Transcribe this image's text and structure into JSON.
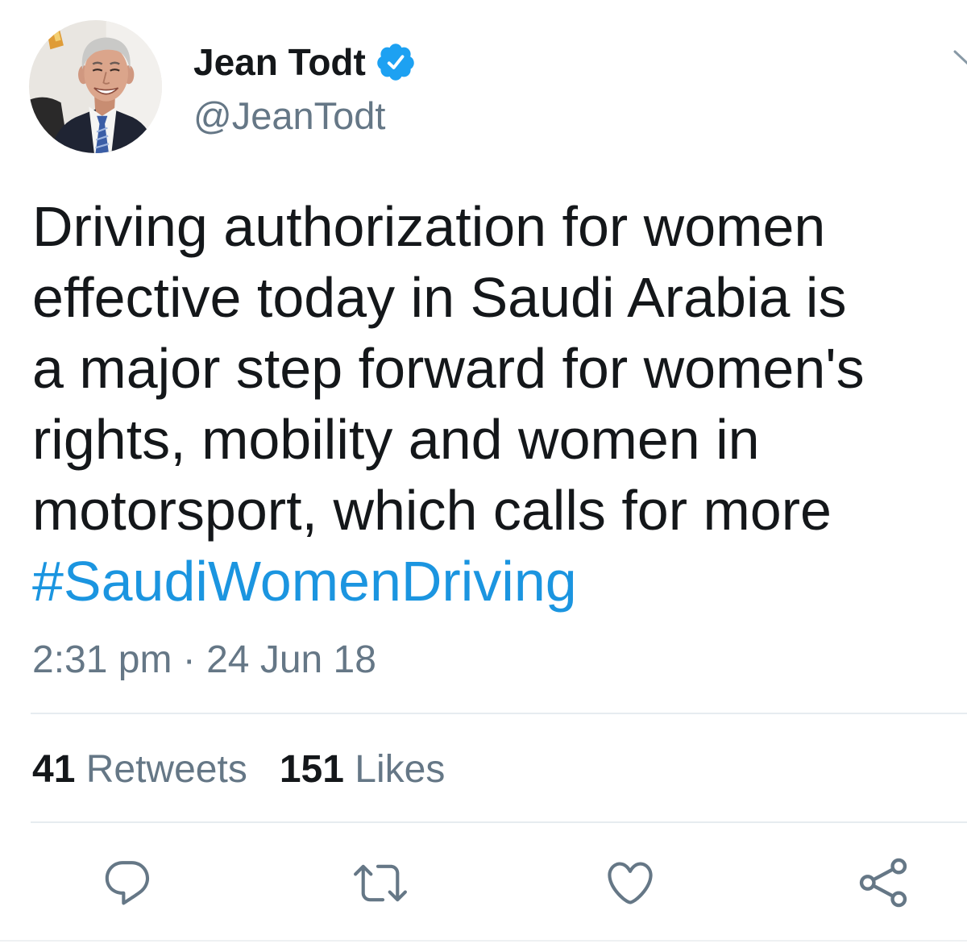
{
  "author": {
    "name": "Jean Todt",
    "handle": "@JeanTodt",
    "verified": true
  },
  "tweet": {
    "text": "Driving authorization for women effective today in Saudi Arabia is a major step forward for women's rights, mobility and women in motorsport, which calls for more",
    "hashtag": "#SaudiWomenDriving",
    "timestamp": "2:31 pm · 24 Jun 18"
  },
  "stats": {
    "retweets_count": "41",
    "retweets_label": "Retweets",
    "likes_count": "151",
    "likes_label": "Likes"
  },
  "icons": {
    "avatar": "avatar-photo",
    "verified": "verified-badge-icon",
    "menu": "chevron-down-icon",
    "reply": "reply-icon",
    "retweet": "retweet-icon",
    "like": "heart-icon",
    "share": "share-icon"
  },
  "colors": {
    "text": "#14171a",
    "secondary": "#657786",
    "link": "#1b95e0",
    "verified": "#1da1f2",
    "divider": "#e6ecf0",
    "background": "#ffffff"
  }
}
